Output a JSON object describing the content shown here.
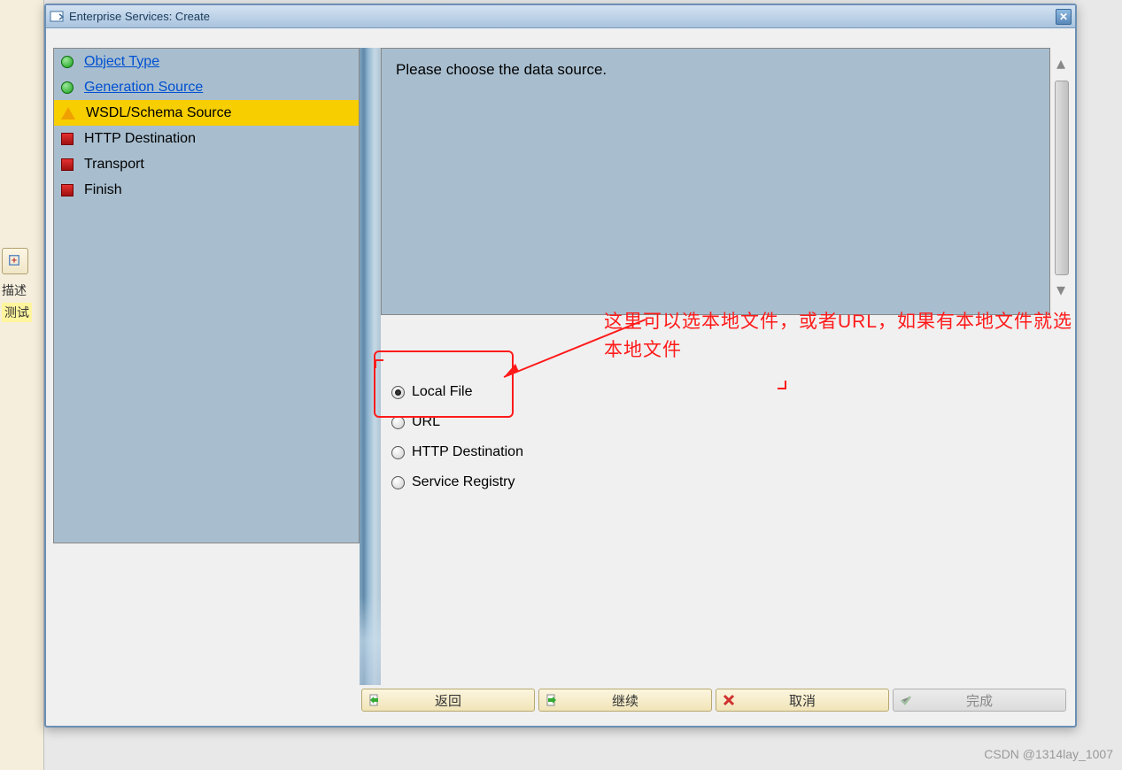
{
  "bg": {
    "label_desc": "描述",
    "label_test": "测试"
  },
  "dialog": {
    "title": "Enterprise Services: Create"
  },
  "nav": {
    "items": [
      {
        "label": "Object Type",
        "state": "done",
        "link": true
      },
      {
        "label": "Generation Source",
        "state": "done",
        "link": true
      },
      {
        "label": "WSDL/Schema Source",
        "state": "current",
        "link": false
      },
      {
        "label": "HTTP Destination",
        "state": "pending",
        "link": false
      },
      {
        "label": "Transport",
        "state": "pending",
        "link": false
      },
      {
        "label": "Finish",
        "state": "pending",
        "link": false
      }
    ]
  },
  "info": {
    "text": "Please choose the data source."
  },
  "radios": {
    "options": [
      {
        "label": "Local File",
        "selected": true
      },
      {
        "label": "URL",
        "selected": false
      },
      {
        "label": "HTTP Destination",
        "selected": false
      },
      {
        "label": "Service Registry",
        "selected": false
      }
    ]
  },
  "annotation": {
    "text": "这里可以选本地文件，或者URL，如果有本地文件就选本地文件"
  },
  "buttons": {
    "back": "返回",
    "continue": "继续",
    "cancel": "取消",
    "finish": "完成"
  },
  "watermark": "CSDN @1314lay_1007"
}
